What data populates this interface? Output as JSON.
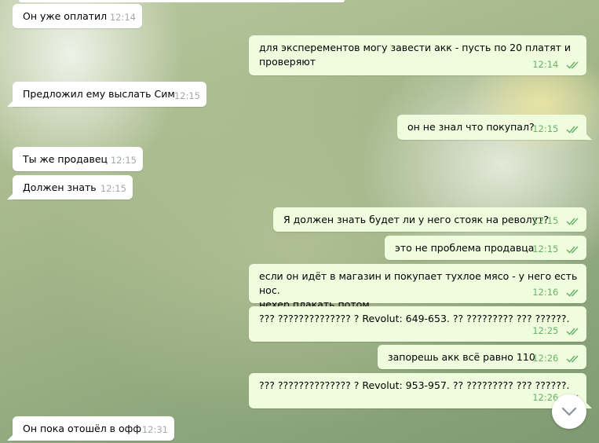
{
  "messages": [
    {
      "id": 1,
      "dir": "in",
      "text": "Он уже оплатил",
      "time": "12:14"
    },
    {
      "id": 2,
      "dir": "out",
      "text": "для эксперементов могу завести акк - пусть по 20 платят и\nпроверяют",
      "time": "12:14"
    },
    {
      "id": 3,
      "dir": "in",
      "text": "Предложил ему выслать Сим",
      "time": "12:15"
    },
    {
      "id": 4,
      "dir": "out",
      "text": "он не знал что покупал?",
      "time": "12:15"
    },
    {
      "id": 5,
      "dir": "in",
      "text": "Ты же продавец",
      "time": "12:15"
    },
    {
      "id": 6,
      "dir": "in",
      "text": "Должен знать",
      "time": "12:15"
    },
    {
      "id": 7,
      "dir": "out",
      "text": "Я должен знать будет ли у него стояк на револут?",
      "time": "12:15"
    },
    {
      "id": 8,
      "dir": "out",
      "text": "это не проблема продавца",
      "time": "12:15"
    },
    {
      "id": 9,
      "dir": "out",
      "text": "если он идёт в магазин и покупает тухлое мясо - у него есть нос.\nнехер плакать потом",
      "time": "12:16"
    },
    {
      "id": 10,
      "dir": "out",
      "text": "??? ?????????????? ? Revolut: 649-653. ?? ????????? ??? ??????.",
      "time": "12:25"
    },
    {
      "id": 11,
      "dir": "out",
      "text": "запорешь акк всё равно 110",
      "time": "12:26"
    },
    {
      "id": 12,
      "dir": "out",
      "text": "??? ?????????????? ? Revolut: 953-957. ?? ????????? ??? ??????.",
      "time": "12:26"
    },
    {
      "id": 13,
      "dir": "in",
      "text": "Он пока отошёл в офф",
      "time": "12:31"
    }
  ],
  "colors": {
    "incoming_bubble": "#ffffff",
    "outgoing_bubble": "#effdde",
    "incoming_time": "#a4a9ad",
    "outgoing_time": "#6ab26a"
  },
  "icons": {
    "read_receipt": "double-check-icon",
    "scroll_down": "chevron-down-icon"
  }
}
